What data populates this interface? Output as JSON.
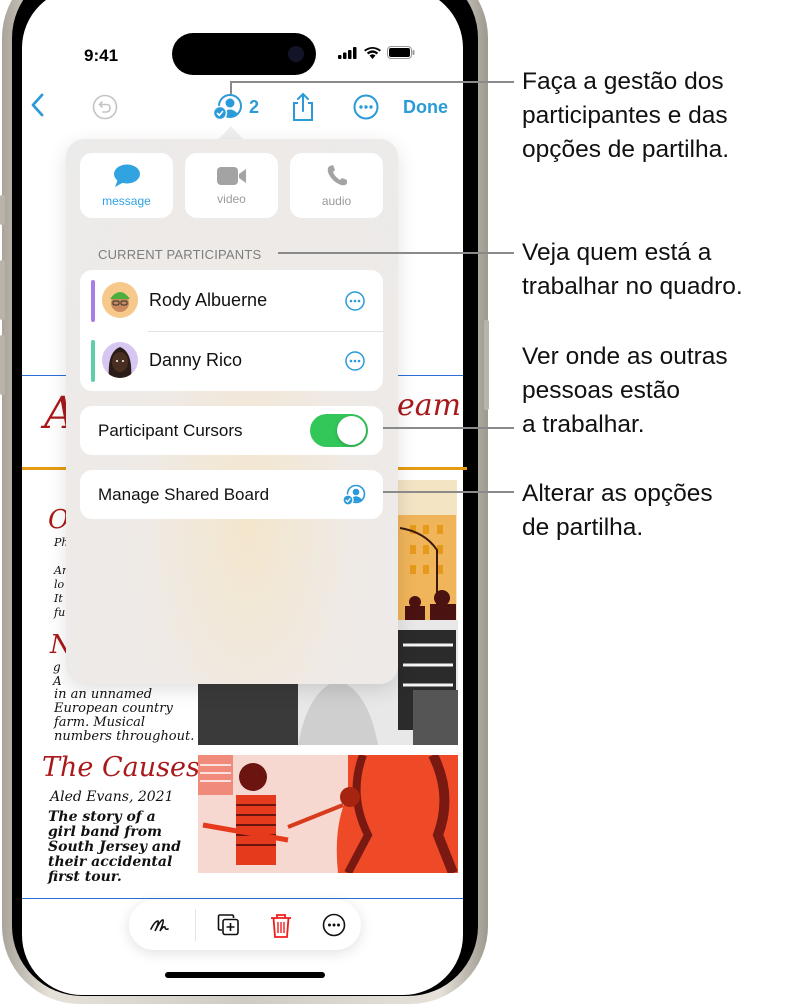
{
  "status_bar": {
    "time": "9:41",
    "icons": [
      "signal-icon",
      "wifi-icon",
      "battery-icon"
    ]
  },
  "toolbar": {
    "back_icon": "chevron-left-icon",
    "undo_icon": "undo-icon",
    "collaborate_icon": "person-checkmark-icon",
    "participant_count": "2",
    "share_icon": "share-icon",
    "more_icon": "ellipsis-circle-icon",
    "done_label": "Done"
  },
  "popover": {
    "communication": [
      {
        "label": "message",
        "icon": "message-bubble-icon",
        "active": true
      },
      {
        "label": "video",
        "icon": "video-camera-icon",
        "active": false
      },
      {
        "label": "audio",
        "icon": "phone-icon",
        "active": false
      }
    ],
    "section_title": "CURRENT PARTICIPANTS",
    "participants": [
      {
        "name": "Rody Albuerne",
        "cursor_color": "#a77ee6",
        "avatar_bg": "#f6c98a"
      },
      {
        "name": "Danny Rico",
        "cursor_color": "#5fcfa8",
        "avatar_bg": "#d7c6f1"
      }
    ],
    "participant_cursors": {
      "label": "Participant Cursors",
      "enabled": true
    },
    "manage_board": {
      "label": "Manage Shared Board",
      "icon": "person-checkmark-icon"
    }
  },
  "board": {
    "headings": [
      "A",
      "eam",
      "O",
      "N.",
      "The Causes"
    ],
    "notes": {
      "n_text": [
        "in an unnamed",
        "European country",
        "farm. Musical",
        "numbers throughout."
      ],
      "causes_byline": "Aled Evans, 2021",
      "causes_text": [
        "The story of a",
        "girl band from",
        "South Jersey and",
        "their accidental",
        "first tour."
      ]
    }
  },
  "bottom_toolbar": {
    "items": [
      "scribble-icon",
      "duplicate-icon",
      "trash-icon",
      "ellipsis-circle-icon"
    ]
  },
  "callouts": [
    {
      "lines": [
        "Faça a gestão dos",
        "participantes e das",
        "opções de partilha."
      ]
    },
    {
      "lines": [
        "Veja quem está a",
        "trabalhar no quadro."
      ]
    },
    {
      "lines": [
        "Ver onde as outras",
        "pessoas estão",
        "a trabalhar."
      ]
    },
    {
      "lines": [
        "Alterar as opções",
        "de partilha."
      ]
    }
  ],
  "colors": {
    "accent": "#2a9ad8",
    "toggle_on": "#33c759",
    "destructive": "#f21c1c",
    "handwriting_red": "#a9191b"
  }
}
